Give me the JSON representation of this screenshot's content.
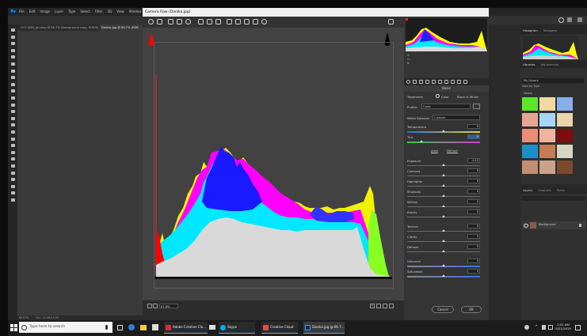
{
  "ps": {
    "logo": "Ps",
    "menu": [
      "File",
      "Edit",
      "Image",
      "Layer",
      "Type",
      "Select",
      "Filter",
      "3D",
      "View",
      "Window",
      "Help"
    ],
    "tabs": [
      {
        "label": "CITY1869_phuong @ 66.7% (Background copy, RGB/8) *"
      },
      {
        "label": "Danika.jpg @ 66.7% (RGB"
      }
    ],
    "status": {
      "zoom": "66.67%",
      "doc": "Doc: 24.0M/24.0M"
    }
  },
  "camera_raw": {
    "title": "Camera Raw (Danika.jpg)",
    "zoom": "67.8%",
    "panel_title": "Basic",
    "treatment_label": "Treatment:",
    "treatment_color": "Color",
    "treatment_bw": "Black & White",
    "profile_label": "Profile:",
    "profile_value": "Color",
    "wb_label": "White Balance:",
    "wb_value": "Custom",
    "auto": "Auto",
    "default": "Default",
    "sliders": [
      {
        "name": "Temperature",
        "value": "0",
        "knob": 0.5
      },
      {
        "name": "Tint",
        "value": "0",
        "knob": 0.2
      },
      {
        "name": "Exposure",
        "value": "-0.15",
        "knob": 0.5
      },
      {
        "name": "Contrast",
        "value": "0",
        "knob": 0.5
      },
      {
        "name": "Highlights",
        "value": "0",
        "knob": 0.5
      },
      {
        "name": "Shadows",
        "value": "0",
        "knob": 0.5
      },
      {
        "name": "Whites",
        "value": "0",
        "knob": 0.5
      },
      {
        "name": "Blacks",
        "value": "0",
        "knob": 0.5
      },
      {
        "name": "Texture",
        "value": "0",
        "knob": 0.5
      },
      {
        "name": "Clarity",
        "value": "0",
        "knob": 0.5
      },
      {
        "name": "Dehaze",
        "value": "0",
        "knob": 0.5
      },
      {
        "name": "Vibrance",
        "value": "0",
        "knob": 0.5
      },
      {
        "name": "Saturation",
        "value": "0",
        "knob": 0.5
      }
    ],
    "readout": [
      "R:",
      "G:",
      "B:"
    ],
    "cancel": "Cancel",
    "ok": "OK"
  },
  "right_panels": {
    "histogram_tabs": [
      "Histogram",
      "Navigator"
    ],
    "libraries_tabs": [
      "Libraries",
      "Adjustments"
    ],
    "library_name": "My Library",
    "view_by": "View by Type",
    "colors_label": "Colors",
    "layers_tabs": [
      "Layers",
      "Channels",
      "Paths"
    ],
    "layer_name": "Background",
    "swatch_colors": [
      "#5ce62a",
      "#f2d9a0",
      "#86aeea",
      "#e5a794",
      "#a7d7f7",
      "#e9d4ab",
      "#ea8d79",
      "#f0b49c",
      "#7a0d0d",
      "#1c8fc9",
      "#c47d57",
      "#d8d4c4",
      "#c18f72",
      "#c9a289",
      "#7b4a2e"
    ]
  },
  "taskbar": {
    "search_placeholder": "Type here to search",
    "apps": [
      "Adobe Creative Clo...",
      "Skype",
      "Creative Cloud",
      "Danika.jpg @ 66.7..."
    ],
    "time": "2:01 AM",
    "date": "5/21/2019"
  }
}
